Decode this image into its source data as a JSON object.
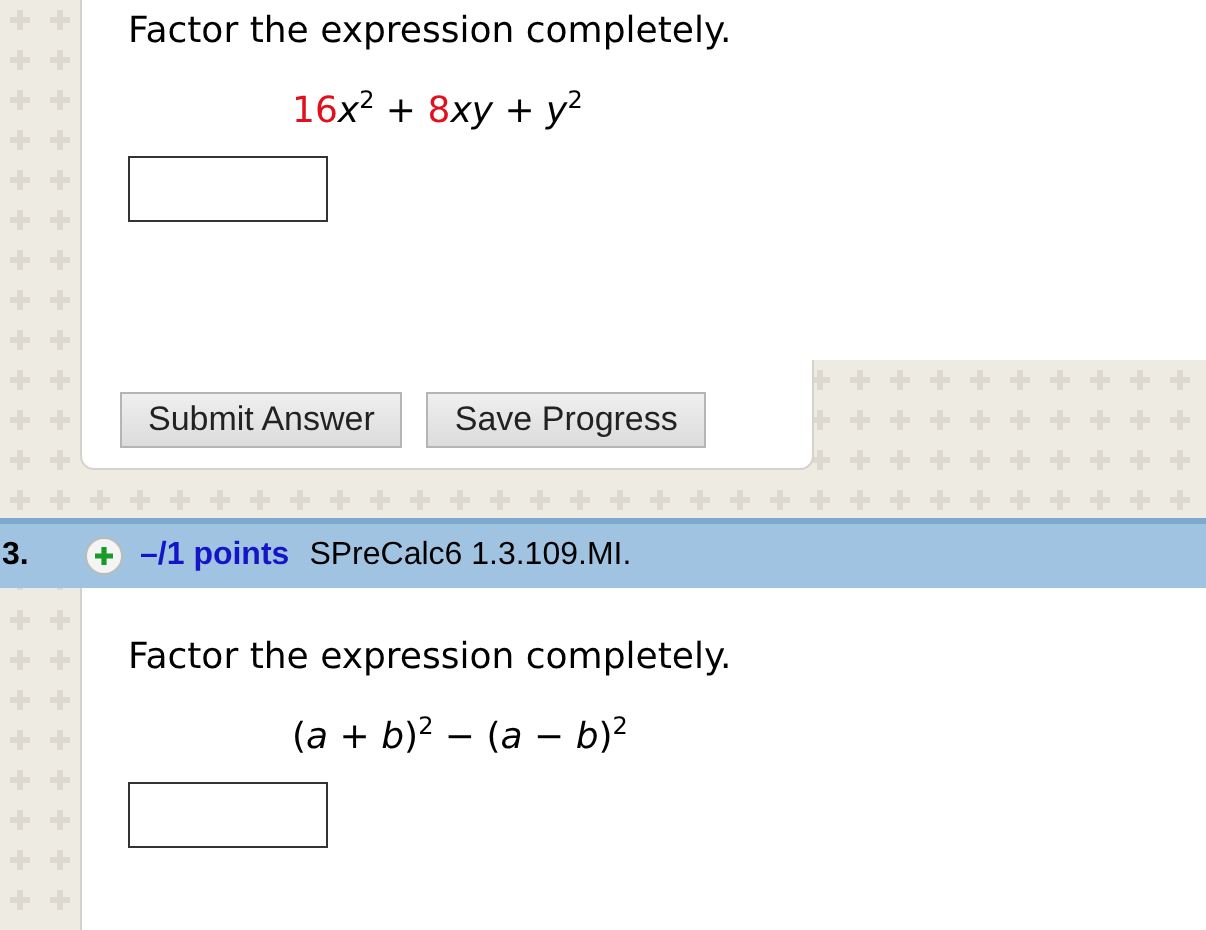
{
  "questions": [
    {
      "prompt": "Factor the expression completely.",
      "expression": [
        {
          "kind": "num",
          "text": "16"
        },
        {
          "kind": "var",
          "text": "x"
        },
        {
          "kind": "sup",
          "text": "2"
        },
        {
          "kind": "op",
          "text": " + "
        },
        {
          "kind": "num",
          "text": "8"
        },
        {
          "kind": "var",
          "text": "xy"
        },
        {
          "kind": "op",
          "text": " + "
        },
        {
          "kind": "var",
          "text": "y"
        },
        {
          "kind": "sup",
          "text": "2"
        }
      ],
      "buttons": [
        "Submit Answer",
        "Save Progress"
      ]
    },
    {
      "number": "3.",
      "points": "–/1 points",
      "code": "SPreCalc6 1.3.109.MI.",
      "prompt": "Factor the expression completely.",
      "expression": [
        {
          "kind": "op",
          "text": "("
        },
        {
          "kind": "var",
          "text": "a"
        },
        {
          "kind": "op",
          "text": " + "
        },
        {
          "kind": "var",
          "text": "b"
        },
        {
          "kind": "op",
          "text": ")"
        },
        {
          "kind": "sup",
          "text": "2"
        },
        {
          "kind": "op",
          "text": " − ("
        },
        {
          "kind": "var",
          "text": "a"
        },
        {
          "kind": "op",
          "text": " − "
        },
        {
          "kind": "var",
          "text": "b"
        },
        {
          "kind": "op",
          "text": ")"
        },
        {
          "kind": "sup",
          "text": "2"
        }
      ]
    }
  ]
}
